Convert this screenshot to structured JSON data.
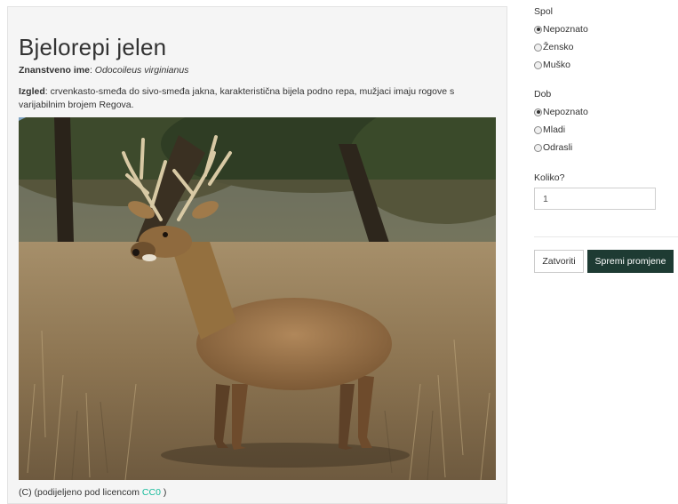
{
  "species": {
    "title": "Bjelorepi jelen",
    "scientific_label": "Znanstveno ime",
    "scientific_name": "Odocoileus virginianus",
    "appearance_label": "Izgled",
    "appearance_text": "crvenkasto-smeđa do sivo-smeđa jakna, karakteristična bijela podno repa, mužjaci imaju rogove s varijabilnim brojem Regova.",
    "license_prefix": "(C) (podijeljeno pod licencom ",
    "license_link": "CC0",
    "license_suffix": " )"
  },
  "form": {
    "sex": {
      "label": "Spol",
      "options": [
        "Nepoznato",
        "Žensko",
        "Muško"
      ],
      "selected": "Nepoznato"
    },
    "age": {
      "label": "Dob",
      "options": [
        "Nepoznato",
        "Mladi",
        "Odrasli"
      ],
      "selected": "Nepoznato"
    },
    "quantity": {
      "label": "Koliko?",
      "value": "1"
    },
    "close_label": "Zatvoriti",
    "save_label": "Spremi promjene"
  },
  "colors": {
    "panel_bg": "#f5f5f5",
    "save_button_bg": "#1e3b33",
    "link": "#18bc9c"
  },
  "icons": {
    "radio_checked": "radio-checked-icon",
    "radio_unchecked": "radio-unchecked-icon"
  }
}
